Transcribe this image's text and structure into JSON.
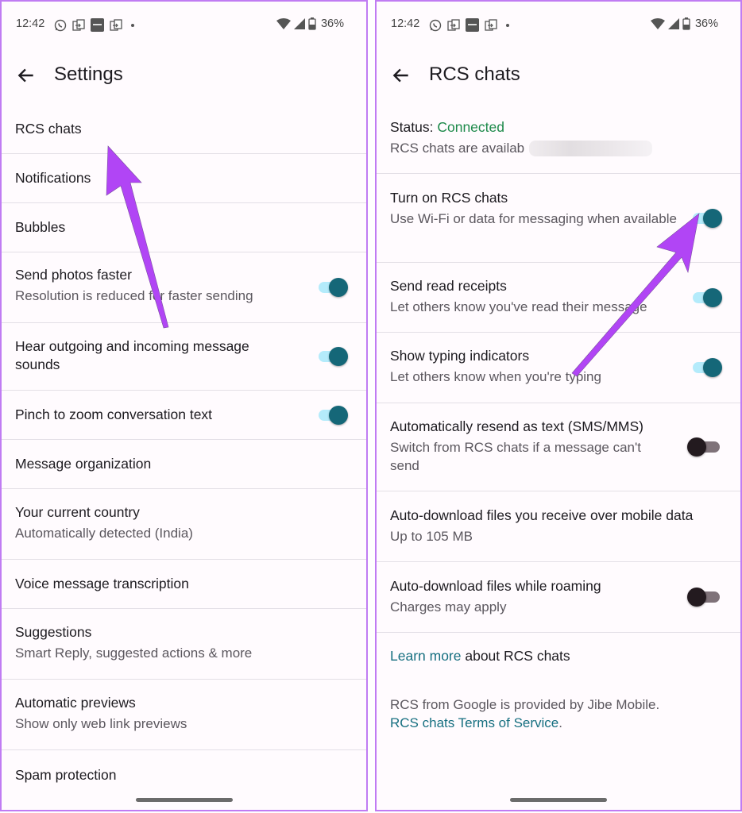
{
  "status_bar": {
    "time": "12:42",
    "notification_icons": [
      "whatsapp-icon",
      "screen-mirror-icon",
      "paytm-icon",
      "screen-mirror-icon",
      "dot-icon"
    ],
    "battery": "36%"
  },
  "left_screen": {
    "title": "Settings",
    "items": [
      {
        "title": "RCS chats"
      },
      {
        "title": "Notifications"
      },
      {
        "title": "Bubbles"
      },
      {
        "title": "Send photos faster",
        "subtitle": "Resolution is reduced for faster sending",
        "toggle": true
      },
      {
        "title": "Hear outgoing and incoming message sounds",
        "toggle": true
      },
      {
        "title": "Pinch to zoom conversation text",
        "toggle": true
      },
      {
        "title": "Message organization"
      },
      {
        "title": "Your current country",
        "subtitle": "Automatically detected (India)"
      },
      {
        "title": "Voice message transcription"
      },
      {
        "title": "Suggestions",
        "subtitle": "Smart Reply, suggested actions & more"
      },
      {
        "title": "Automatic previews",
        "subtitle": "Show only web link previews"
      },
      {
        "title": "Spam protection"
      }
    ]
  },
  "right_screen": {
    "title": "RCS chats",
    "status": {
      "label": "Status: ",
      "value": "Connected",
      "subtitle": "RCS chats are availab"
    },
    "items": [
      {
        "title": "Turn on RCS chats",
        "subtitle": "Use Wi-Fi or data for messaging when available",
        "toggle": true
      },
      {
        "title": "Send read receipts",
        "subtitle": "Let others know you've read their message",
        "toggle": true
      },
      {
        "title": "Show typing indicators",
        "subtitle": "Let others know when you're typing",
        "toggle": true
      },
      {
        "title": "Automatically resend as text (SMS/MMS)",
        "subtitle": "Switch from RCS chats if a message can't send",
        "toggle": false
      },
      {
        "title": "Auto-download files you receive over mobile data",
        "subtitle": "Up to 105 MB"
      },
      {
        "title": "Auto-download files while roaming",
        "subtitle": "Charges may apply",
        "toggle": false
      }
    ],
    "learn_more": {
      "link": "Learn more",
      "text": " about RCS chats"
    },
    "footer": {
      "text": "RCS from Google is provided by Jibe Mobile.",
      "link": "RCS chats Terms of Service",
      "suffix": "."
    }
  },
  "colors": {
    "accent": "#156778",
    "status_connected": "#1e8a4b",
    "annotation_arrow": "#b145f5",
    "frame_border": "#c07cf3"
  }
}
